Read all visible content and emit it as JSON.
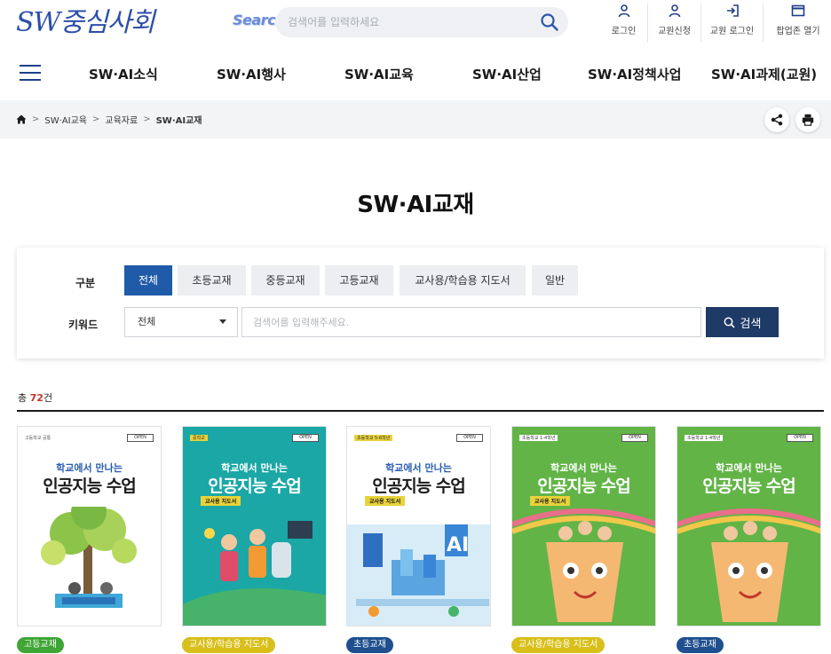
{
  "header": {
    "logo_text": "SW중심사회",
    "search_word": "Search",
    "search_placeholder": "검색어를 입력하세요",
    "utilities": [
      {
        "label": "로그인",
        "icon": "user-icon"
      },
      {
        "label": "교원신청",
        "icon": "user-icon"
      },
      {
        "label": "교원 로그인",
        "icon": "login-icon"
      },
      {
        "label": "팝업존 열기",
        "icon": "window-icon"
      }
    ]
  },
  "nav": {
    "items": [
      "SW·AI소식",
      "SW·AI행사",
      "SW·AI교육",
      "SW·AI산업",
      "SW·AI정책사업",
      "SW·AI과제(교원)"
    ]
  },
  "breadcrumb": {
    "items": [
      "SW·AI교육",
      "교육자료"
    ],
    "current": "SW·AI교재"
  },
  "page": {
    "title": "SW·AI교재"
  },
  "filter": {
    "category_label": "구분",
    "categories": [
      "전체",
      "초등교재",
      "중등교재",
      "고등교재",
      "교사용/학습용 지도서",
      "일반"
    ],
    "active_category": "전체",
    "keyword_label": "키워드",
    "select_value": "전체",
    "keyword_placeholder": "검색어를 입력해주세요.",
    "search_button": "검색"
  },
  "results": {
    "total_prefix": "총 ",
    "total_count": "72",
    "total_suffix": "건"
  },
  "books": [
    {
      "top_tag": "고등학교 공통",
      "title_line1": "학교에서 만나는",
      "title_line2": "인공지능 수업",
      "subtitle": "",
      "badge": "고등교재",
      "badge_color": "#3fa535",
      "cover_bg": "#ffffff"
    },
    {
      "top_tag": "중학교",
      "title_line1": "학교에서 만나는",
      "title_line2": "인공지능 수업",
      "subtitle": "교사용 지도서",
      "badge": "교사용/학습용 지도서",
      "badge_color": "#d8bf1a",
      "cover_bg": "#1aa7a6"
    },
    {
      "top_tag": "초등학교 5-6학년",
      "title_line1": "학교에서 만나는",
      "title_line2": "인공지능 수업",
      "subtitle": "교사용 지도서",
      "badge": "초등교재",
      "badge_color": "#1f4f8f",
      "cover_bg": "#ffffff"
    },
    {
      "top_tag": "초등학교 1-4학년",
      "title_line1": "학교에서 만나는",
      "title_line2": "인공지능 수업",
      "subtitle": "교사용 지도서",
      "badge": "교사용/학습용 지도서",
      "badge_color": "#d8bf1a",
      "cover_bg": "#62b447"
    },
    {
      "top_tag": "초등학교 1-4학년",
      "title_line1": "학교에서 만나는",
      "title_line2": "인공지능 수업",
      "subtitle": "",
      "badge": "초등교재",
      "badge_color": "#1f4f8f",
      "cover_bg": "#62b447"
    }
  ]
}
